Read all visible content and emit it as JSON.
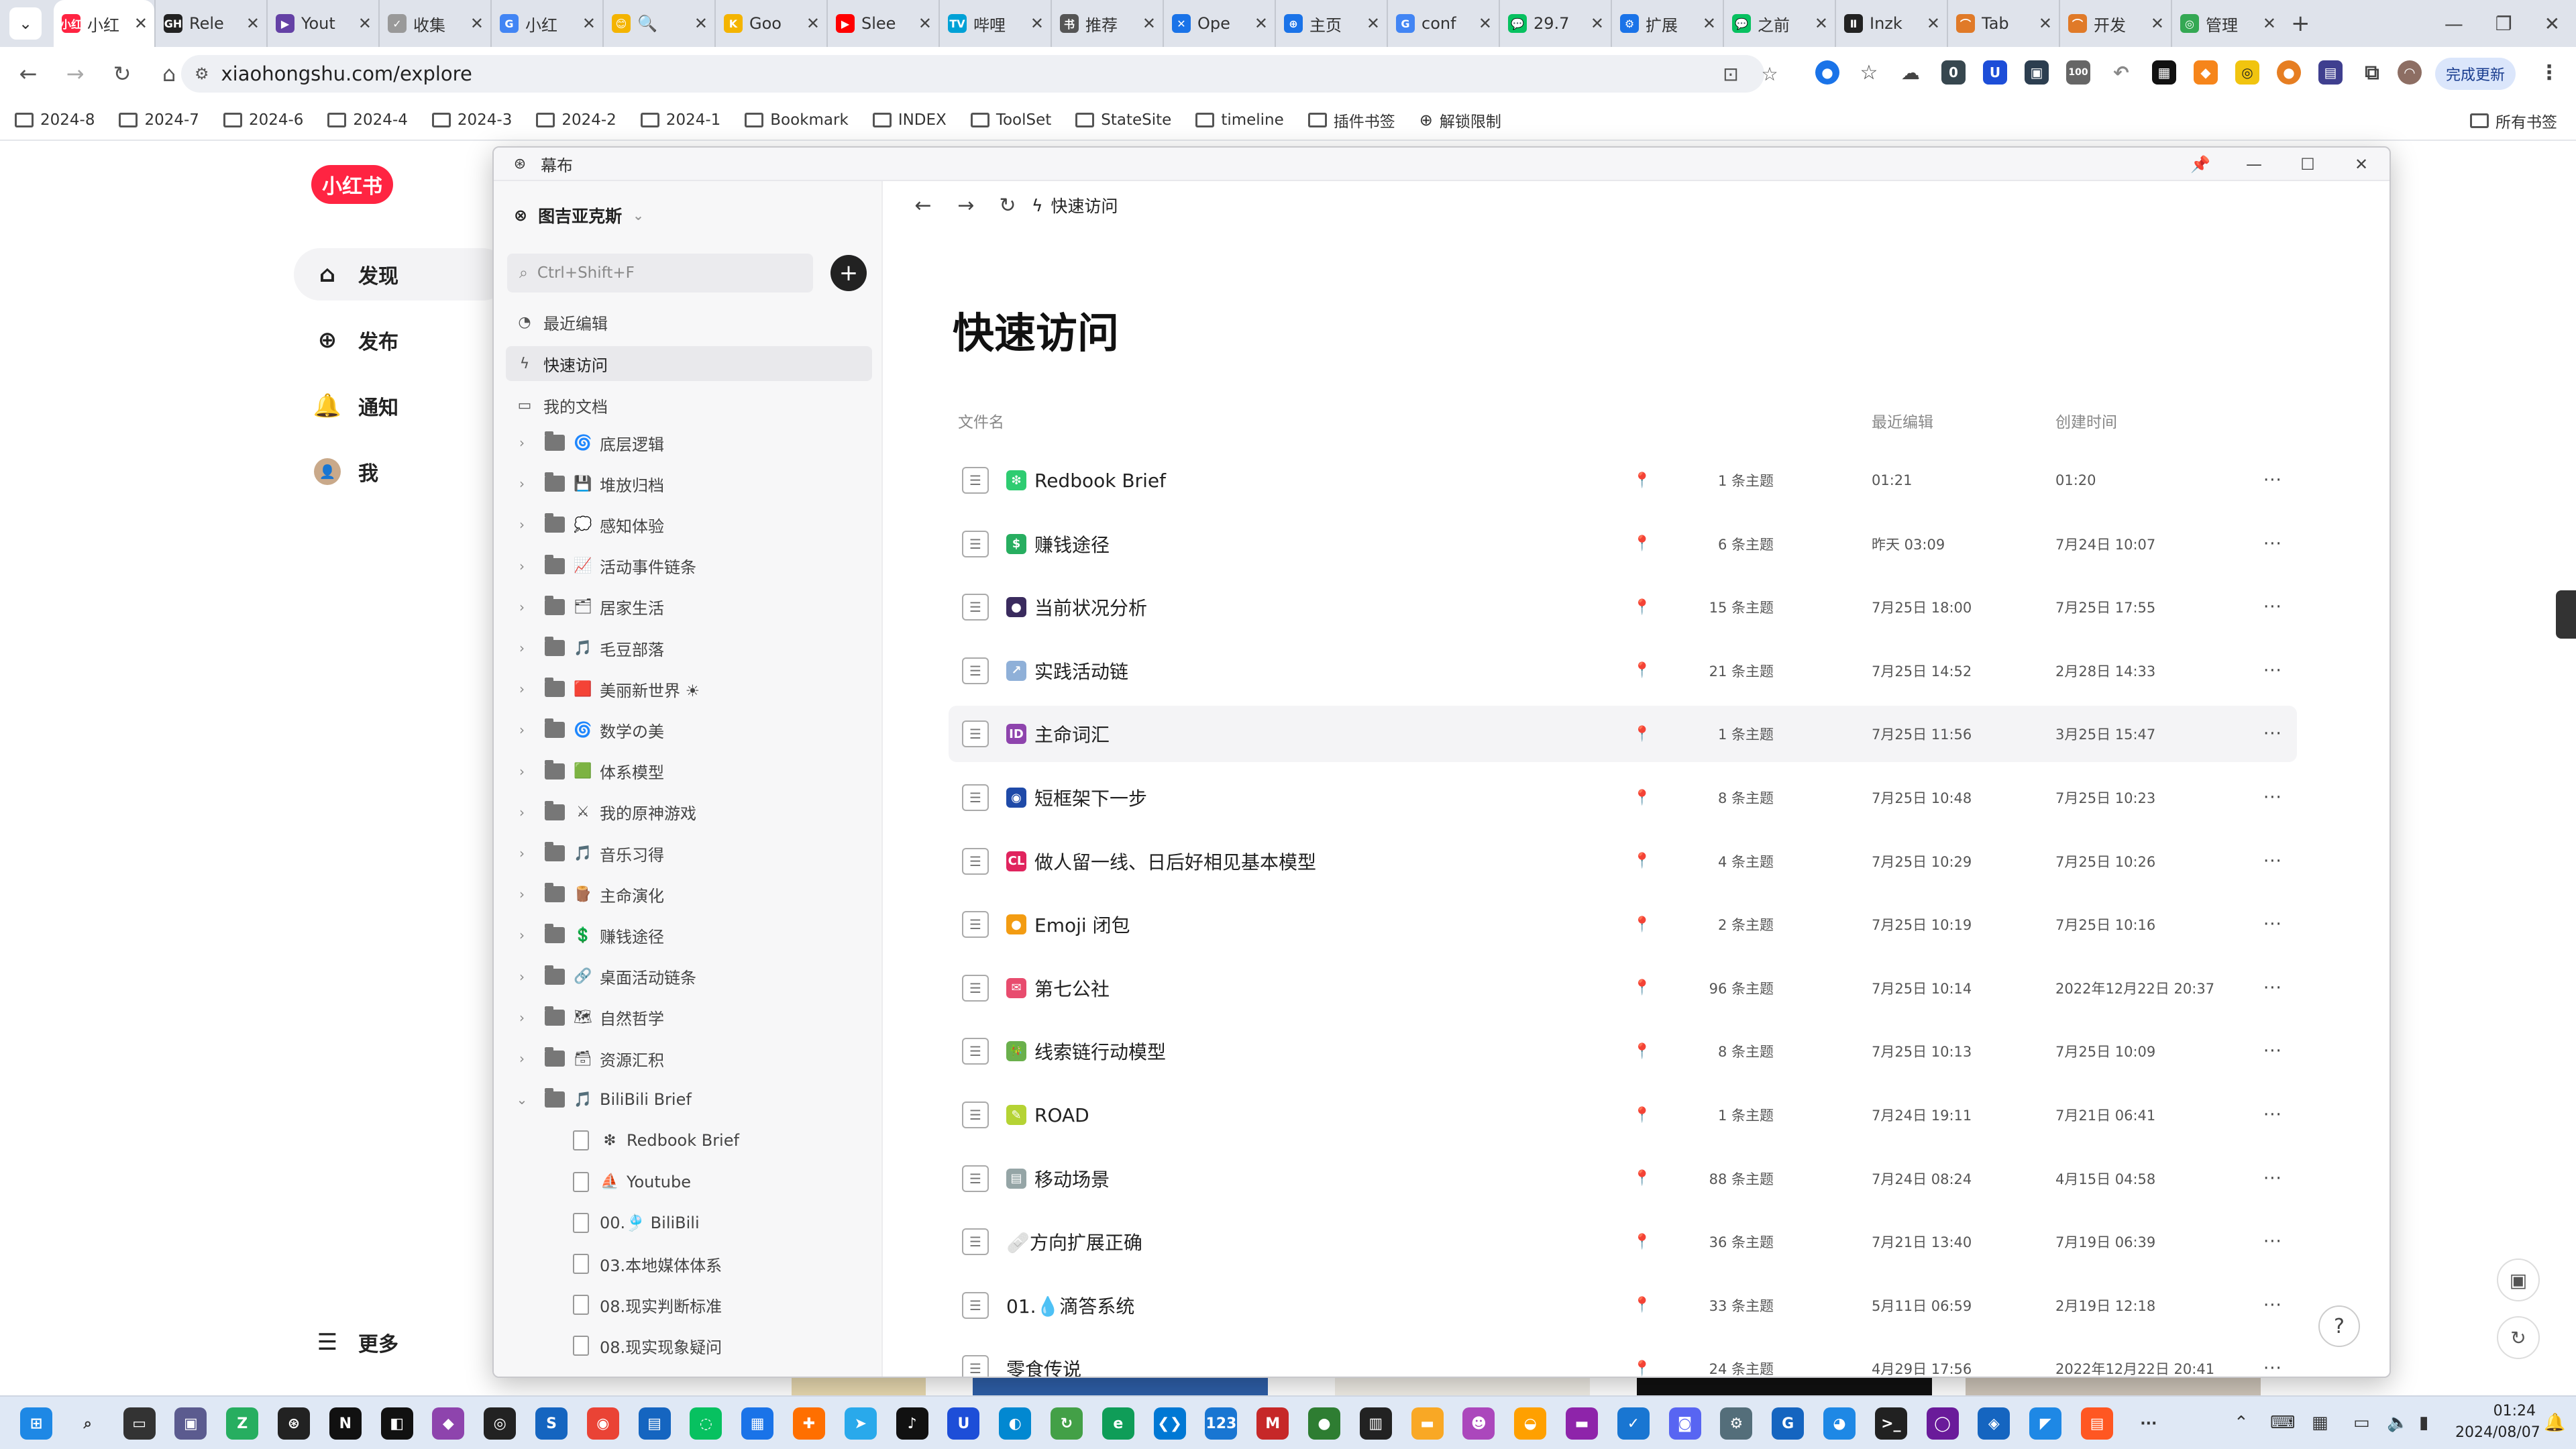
{
  "browser": {
    "tabs": [
      {
        "label": "小红",
        "color": "#ff2442",
        "fav": "小红"
      },
      {
        "label": "Rele",
        "color": "#222222",
        "fav": "GH"
      },
      {
        "label": "Yout",
        "color": "#6441a5",
        "fav": "▶"
      },
      {
        "label": "收集",
        "color": "#999999",
        "fav": "✓"
      },
      {
        "label": "小红",
        "color": "#4285f4",
        "fav": "G"
      },
      {
        "label": "🔍",
        "color": "#f4b400",
        "fav": "😊"
      },
      {
        "label": "Goo",
        "color": "#f4b400",
        "fav": "K"
      },
      {
        "label": "Slee",
        "color": "#ff0000",
        "fav": "▶"
      },
      {
        "label": "哔哩",
        "color": "#00a1d6",
        "fav": "TV"
      },
      {
        "label": "推荐",
        "color": "#555555",
        "fav": "书"
      },
      {
        "label": "Ope",
        "color": "#1a73e8",
        "fav": "✕"
      },
      {
        "label": "主页",
        "color": "#1a73e8",
        "fav": "⊕"
      },
      {
        "label": "conf",
        "color": "#4285f4",
        "fav": "G"
      },
      {
        "label": "29.7",
        "color": "#07c160",
        "fav": "💬"
      },
      {
        "label": "扩展",
        "color": "#1a73e8",
        "fav": "⚙"
      },
      {
        "label": "之前",
        "color": "#07c160",
        "fav": "💬"
      },
      {
        "label": "Inzk",
        "color": "#222222",
        "fav": "Ⅱ"
      },
      {
        "label": "Tab",
        "color": "#e07a28",
        "fav": "⌒"
      },
      {
        "label": "开发",
        "color": "#e07a28",
        "fav": "⌒"
      },
      {
        "label": "管理",
        "color": "#34a853",
        "fav": "◎"
      }
    ],
    "url": "xiaohongshu.com/explore",
    "update_label": "完成更新",
    "bookmarks": [
      "2024-8",
      "2024-7",
      "2024-6",
      "2024-4",
      "2024-3",
      "2024-2",
      "2024-1",
      "Bookmark",
      "INDEX",
      "ToolSet",
      "StateSite",
      "timeline",
      "插件书签",
      "解锁限制"
    ],
    "all_bookmarks": "所有书签",
    "ext_badges": {
      "badge1": "0",
      "badge2": "100"
    }
  },
  "xhs": {
    "logo": "小红书",
    "nav": [
      "发现",
      "发布",
      "通知",
      "我"
    ],
    "more": "更多"
  },
  "mubu": {
    "window_title": "幕布",
    "workspace": "图吉亚克斯",
    "search_placeholder": "Ctrl+Shift+F",
    "side_items": [
      "最近编辑",
      "快速访问",
      "我的文档"
    ],
    "folders": [
      {
        "emoji": "🌀",
        "label": "底层逻辑"
      },
      {
        "emoji": "💾",
        "label": "堆放归档"
      },
      {
        "emoji": "💭",
        "label": "感知体验"
      },
      {
        "emoji": "📈",
        "label": "活动事件链条"
      },
      {
        "emoji": "🗂",
        "label": "居家生活"
      },
      {
        "emoji": "🎵",
        "label": "毛豆部落"
      },
      {
        "emoji": "🟥",
        "label": "美丽新世界 ☀"
      },
      {
        "emoji": "🌀",
        "label": "数学の美"
      },
      {
        "emoji": "🟩",
        "label": "体系模型"
      },
      {
        "emoji": "⚔",
        "label": "我的原神游戏"
      },
      {
        "emoji": "🎵",
        "label": "音乐习得"
      },
      {
        "emoji": "🪵",
        "label": "主命演化"
      },
      {
        "emoji": "💲",
        "label": "赚钱途径"
      },
      {
        "emoji": "🔗",
        "label": "桌面活动链条"
      },
      {
        "emoji": "🗺",
        "label": "自然哲学"
      },
      {
        "emoji": "🗃",
        "label": "资源汇积"
      },
      {
        "emoji": "🎵",
        "label": "BiliBili Brief"
      }
    ],
    "subdocs": [
      {
        "emoji": "❇",
        "label": "Redbook Brief"
      },
      {
        "emoji": "⛵",
        "label": "Youtube"
      },
      {
        "emoji": "",
        "label": "00.🎐 BiliBili"
      },
      {
        "emoji": "",
        "label": "03.本地媒体体系"
      },
      {
        "emoji": "",
        "label": "08.现实判断标准"
      },
      {
        "emoji": "",
        "label": "08.现实现象疑问"
      }
    ],
    "breadcrumb": "快速访问",
    "page_title": "快速访问",
    "columns": {
      "name": "文件名",
      "edited": "最近编辑",
      "created": "创建时间"
    },
    "rows": [
      {
        "emoji": "❇",
        "emoji_color": "#2ecc71",
        "name": "Redbook Brief",
        "count": "1 条主题",
        "edited": "01:21",
        "created": "01:20"
      },
      {
        "emoji": "$",
        "emoji_color": "#27ae60",
        "name": "赚钱途径",
        "count": "6 条主题",
        "edited": "昨天 03:09",
        "created": "7月24日 10:07"
      },
      {
        "emoji": "●",
        "emoji_color": "#3a2b5e",
        "name": "当前状况分析",
        "count": "15 条主题",
        "edited": "7月25日 18:00",
        "created": "7月25日 17:55"
      },
      {
        "emoji": "↗",
        "emoji_color": "#8fb0d8",
        "name": "实践活动链",
        "count": "21 条主题",
        "edited": "7月25日 14:52",
        "created": "2月28日 14:33"
      },
      {
        "emoji": "ID",
        "emoji_color": "#8e44ad",
        "name": "主命词汇",
        "count": "1 条主题",
        "edited": "7月25日 11:56",
        "created": "3月25日 15:47"
      },
      {
        "emoji": "◉",
        "emoji_color": "#1f4aa8",
        "name": "短框架下一步",
        "count": "8 条主题",
        "edited": "7月25日 10:48",
        "created": "7月25日 10:23"
      },
      {
        "emoji": "CL",
        "emoji_color": "#e0245e",
        "name": "做人留一线、日后好相见基本模型",
        "count": "4 条主题",
        "edited": "7月25日 10:29",
        "created": "7月25日 10:26"
      },
      {
        "emoji": "●",
        "emoji_color": "#f39c12",
        "name": "Emoji 闭包",
        "count": "2 条主题",
        "edited": "7月25日 10:19",
        "created": "7月25日 10:16"
      },
      {
        "emoji": "✉",
        "emoji_color": "#e84c6e",
        "name": "第七公社",
        "count": "96 条主题",
        "edited": "7月25日 10:14",
        "created": "2022年12月22日 20:37"
      },
      {
        "emoji": "🎋",
        "emoji_color": "#6ab04c",
        "name": "线索链行动模型",
        "count": "8 条主题",
        "edited": "7月25日 10:13",
        "created": "7月25日 10:09"
      },
      {
        "emoji": "✎",
        "emoji_color": "#b5d334",
        "name": "ROAD",
        "count": "1 条主题",
        "edited": "7月24日 19:11",
        "created": "7月21日 06:41"
      },
      {
        "emoji": "▤",
        "emoji_color": "#95a5a6",
        "name": "移动场景",
        "count": "88 条主题",
        "edited": "7月24日 08:24",
        "created": "4月15日 04:58"
      },
      {
        "emoji": "",
        "emoji_color": "",
        "name": "🩹方向扩展正确",
        "count": "36 条主题",
        "edited": "7月21日 13:40",
        "created": "7月19日 06:39"
      },
      {
        "emoji": "",
        "emoji_color": "",
        "name": "01.💧滴答系统",
        "count": "33 条主题",
        "edited": "5月11日 06:59",
        "created": "2月19日 12:18"
      },
      {
        "emoji": "",
        "emoji_color": "",
        "name": "零食传说",
        "count": "24 条主题",
        "edited": "4月29日 17:56",
        "created": "2022年12月22日 20:41"
      }
    ]
  },
  "taskbar": {
    "time": "01:24",
    "date": "2024/08/07"
  }
}
